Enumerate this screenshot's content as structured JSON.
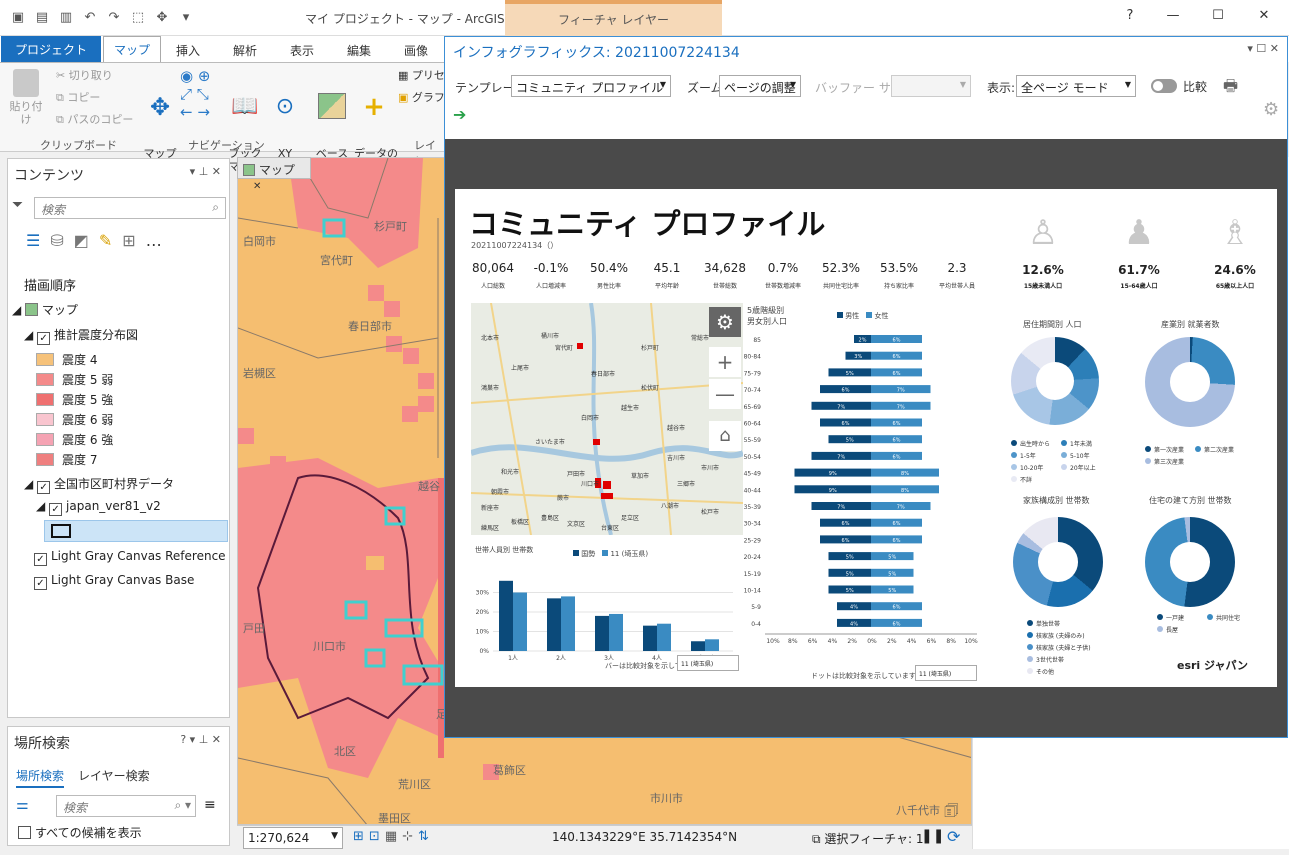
{
  "window": {
    "title": "マイ プロジェクト - マップ - ArcGIS Pro",
    "context_tab": "フィーチャ レイヤー",
    "help": "?"
  },
  "ribbon": {
    "tabs": [
      "プロジェクト",
      "マップ",
      "挿入",
      "解析",
      "表示",
      "編集",
      "画像"
    ],
    "clipboard": {
      "paste": "貼り付け",
      "cut": "切り取り",
      "copy": "コピー",
      "copy_path": "パスのコピー",
      "group": "クリップボード"
    },
    "navigation": {
      "explore": "マップ\n操作",
      "bookmarks": "ブック\nマーク",
      "goto_xy": "XY\nへ移動",
      "group": "ナビゲーション"
    },
    "layer": {
      "basemap": "ベース\nマップ",
      "add_data": "データの\n追加",
      "preset": "プリセ",
      "graphic": "グラフ",
      "group": "レイヤ"
    }
  },
  "contents": {
    "title": "コンテンツ",
    "search_placeholder": "検索",
    "drawing_order": "描画順序",
    "map": "マップ",
    "layer1": "推計震度分布図",
    "legend": [
      {
        "label": "震度 4",
        "color": "#f6c27a"
      },
      {
        "label": "震度 5 弱",
        "color": "#f48a8a"
      },
      {
        "label": "震度 5 強",
        "color": "#ef7070"
      },
      {
        "label": "震度 6 弱",
        "color": "#f9c5cf"
      },
      {
        "label": "震度 6 強",
        "color": "#f5a3b3"
      },
      {
        "label": "震度 7",
        "color": "#ef7f7f"
      }
    ],
    "layer2": "全国市区町村界データ",
    "layer3": "japan_ver81_v2",
    "layer4": "Light Gray Canvas Reference",
    "layer5": "Light Gray Canvas Base"
  },
  "locate": {
    "title": "場所検索",
    "tab1": "場所検索",
    "tab2": "レイヤー検索",
    "search_placeholder": "検索",
    "show_all": "すべての候補を表示"
  },
  "map": {
    "tab": "マップ",
    "labels": [
      "白岡市",
      "杉戸町",
      "宮代町",
      "春日部市",
      "岩槻区",
      "越谷",
      "川口市",
      "戸田",
      "北区",
      "荒川区",
      "葛飾区",
      "市川市",
      "足立",
      "八千代市",
      "墨田区"
    ],
    "scale": "1:270,624",
    "coords": "140.1343229°E 35.7142354°N",
    "selected": "選択フィーチャ: 1"
  },
  "infographic": {
    "title": "インフォグラフィックス: 20211007224134",
    "template_label": "テンプレート:",
    "template_value": "コミュニティ プロファイル",
    "zoom_label": "ズーム:",
    "zoom_value": "ページの調整",
    "buffer_label": "バッファー サイズ:",
    "display_label": "表示:",
    "display_value": "全ページ モード",
    "compare_label": "比較",
    "report": {
      "title": "コミュニティ プロファイル",
      "subtitle": "20211007224134（）",
      "stats": [
        {
          "value": "80,064",
          "label": "人口総数"
        },
        {
          "value": "-0.1%",
          "label": "人口増減率"
        },
        {
          "value": "50.4%",
          "label": "男性比率"
        },
        {
          "value": "45.1",
          "label": "平均年齢"
        },
        {
          "value": "34,628",
          "label": "世帯総数"
        },
        {
          "value": "0.7%",
          "label": "世帯数増減率"
        },
        {
          "value": "52.3%",
          "label": "共同住宅比率"
        },
        {
          "value": "53.5%",
          "label": "持ち家比率"
        },
        {
          "value": "2.3",
          "label": "平均世帯人員"
        }
      ],
      "age_groups": [
        {
          "value": "12.6%",
          "label": "15歳未満人口"
        },
        {
          "value": "61.7%",
          "label": "15-64歳人口"
        },
        {
          "value": "24.6%",
          "label": "65歳以上人口"
        }
      ],
      "pyramid_title": "5歳階級別\n男女別人口",
      "legend_male": "男性",
      "legend_female": "女性",
      "household_title": "世帯人員別 世帯数",
      "legend_national": "国勢",
      "legend_area": "11 (埼玉県)",
      "bar_categories": [
        "1人",
        "2人",
        "3人",
        "4人",
        "5人以上"
      ],
      "bar_national": [
        36,
        27,
        18,
        13,
        5
      ],
      "bar_area": [
        30,
        28,
        19,
        14,
        6
      ],
      "bar_note": "バーは比較対象を示しています",
      "dot_note": "ドットは比較対象を示しています",
      "compare_option": "11 (埼玉県)",
      "donut_titles": [
        "居住期間別 人口",
        "産業別 就業者数",
        "家族構成別 世帯数",
        "住宅の建て方別 世帯数"
      ],
      "residence_legend": [
        "出生時から",
        "1年未満",
        "1-5年",
        "5-10年",
        "10-20年",
        "20年以上",
        "不詳"
      ],
      "industry_legend": [
        "第一次産業",
        "第二次産業",
        "第三次産業"
      ],
      "family_legend": [
        "単独世帯",
        "核家族 (夫婦のみ)",
        "核家族 (夫婦と子供)",
        "3世代世帯",
        "その他"
      ],
      "housing_legend": [
        "一戸建",
        "共同住宅",
        "長屋"
      ],
      "brand": "esri ジャパン",
      "pyramid_ages": [
        "85",
        "80-84",
        "75-79",
        "70-74",
        "65-69",
        "60-64",
        "55-59",
        "50-54",
        "45-49",
        "40-44",
        "35-39",
        "30-34",
        "25-29",
        "20-24",
        "15-19",
        "10-14",
        "5-9",
        "0-4"
      ],
      "pyramid_male": [
        2,
        3,
        5,
        6,
        7,
        6,
        5,
        7,
        9,
        9,
        7,
        6,
        6,
        5,
        5,
        5,
        4,
        4
      ],
      "pyramid_female": [
        6,
        6,
        6,
        7,
        7,
        6,
        6,
        6,
        8,
        8,
        7,
        6,
        6,
        5,
        5,
        5,
        6,
        6
      ],
      "pyramid_axis": [
        "10%",
        "8%",
        "6%",
        "4%",
        "2%",
        "0%",
        "2%",
        "4%",
        "6%",
        "8%",
        "10%"
      ],
      "mini_map_labels": [
        "北本市",
        "桶川市",
        "上尾市",
        "鴻巣市",
        "さいたま市",
        "川口市",
        "草加市",
        "越谷市",
        "春日部市",
        "宮代町",
        "蕨市",
        "戸田市",
        "朝霞市",
        "和光市",
        "新座市",
        "足立区",
        "板橋区",
        "練馬区",
        "豊島区",
        "文京区",
        "台東区",
        "松伏町",
        "吉川市",
        "三郷市",
        "八潮市",
        "常総市",
        "松戸市",
        "市川市",
        "越生市",
        "白岡市",
        "杉戸町"
      ]
    }
  }
}
